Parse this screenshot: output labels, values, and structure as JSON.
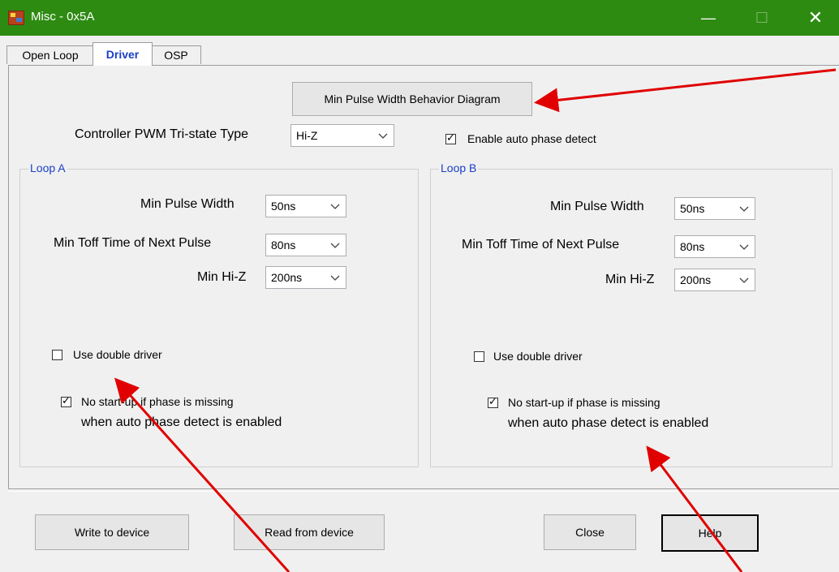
{
  "window": {
    "title": "Misc - 0x5A",
    "minimize_label": "—",
    "maximize_label": "☐",
    "close_label": "✕"
  },
  "tabs": [
    {
      "label": "Open Loop"
    },
    {
      "label": "Driver"
    },
    {
      "label": "OSP"
    }
  ],
  "active_tab": "Driver",
  "diagram_button": "Min Pulse Width Behavior Diagram",
  "controller_pwm": {
    "label": "Controller PWM Tri-state Type",
    "value": "Hi-Z"
  },
  "enable_auto_phase": {
    "label": "Enable auto phase detect",
    "checked": true
  },
  "loop_a": {
    "title": "Loop A",
    "min_pulse_width": {
      "label": "Min Pulse Width",
      "value": "50ns"
    },
    "min_toff": {
      "label": "Min Toff Time of Next Pulse",
      "value": "80ns"
    },
    "min_hiz": {
      "label": "Min Hi-Z",
      "value": "200ns"
    },
    "double_driver": {
      "label": "Use double driver",
      "checked": false
    },
    "no_startup": {
      "line1": "No start-up if phase is missing",
      "line2": "when auto phase detect is enabled",
      "checked": true
    }
  },
  "loop_b": {
    "title": "Loop B",
    "min_pulse_width": {
      "label": "Min Pulse Width",
      "value": "50ns"
    },
    "min_toff": {
      "label": "Min Toff Time of Next Pulse",
      "value": "80ns"
    },
    "min_hiz": {
      "label": "Min Hi-Z",
      "value": "200ns"
    },
    "double_driver": {
      "label": "Use double driver",
      "checked": false
    },
    "no_startup": {
      "line1": "No start-up if phase is missing",
      "line2": "when auto phase detect is enabled",
      "checked": true
    }
  },
  "buttons": {
    "write": "Write to device",
    "read": "Read from device",
    "close": "Close",
    "help": "Help"
  },
  "colors": {
    "titlebar": "#2e8b12",
    "group_title": "#1a3fc7",
    "annotation_arrow": "#e00000"
  }
}
